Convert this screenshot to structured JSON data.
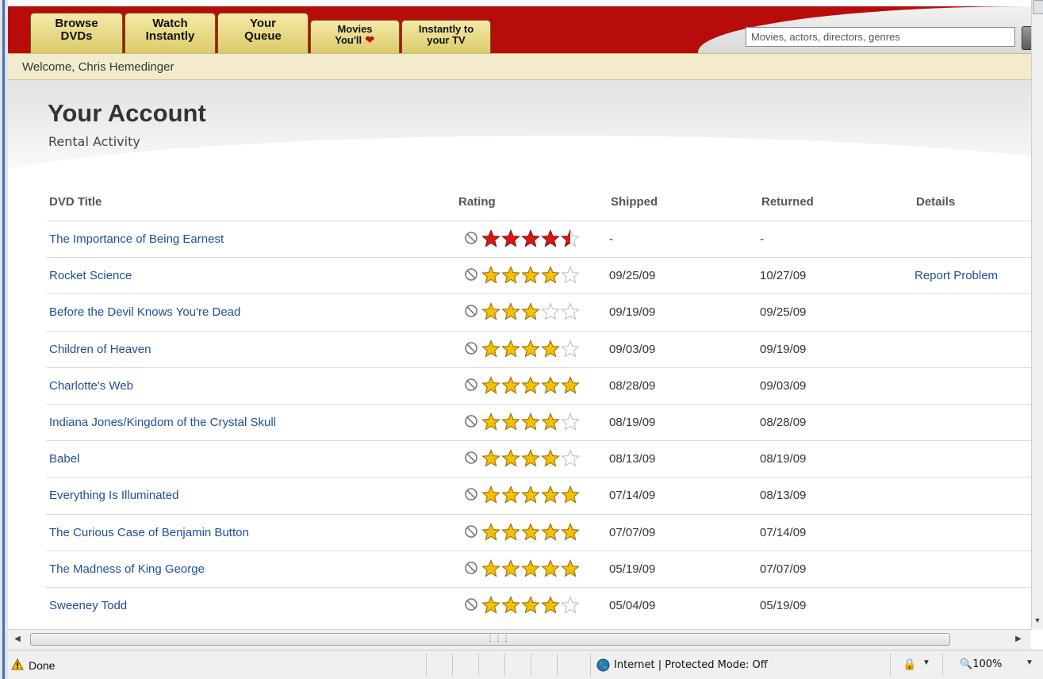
{
  "nav": {
    "tabs": [
      {
        "line1": "Browse",
        "line2": "DVDs"
      },
      {
        "line1": "Watch",
        "line2": "Instantly"
      },
      {
        "line1": "Your",
        "line2": "Queue"
      },
      {
        "line1": "Movies",
        "line2": "You'll"
      },
      {
        "line1": "Instantly to",
        "line2": "your TV"
      }
    ],
    "search_placeholder": "Movies, actors, directors, genres"
  },
  "welcome": "Welcome, Chris Hemedinger",
  "page": {
    "title": "Your Account",
    "subtitle": "Rental Activity"
  },
  "table": {
    "headers": {
      "title": "DVD Title",
      "rating": "Rating",
      "shipped": "Shipped",
      "returned": "Returned",
      "details": "Details"
    },
    "rows": [
      {
        "title": "The Importance of Being Earnest",
        "stars": 4.5,
        "star_color": "red",
        "shipped": "-",
        "returned": "-",
        "details": ""
      },
      {
        "title": "Rocket Science",
        "stars": 4,
        "star_color": "gold",
        "shipped": "09/25/09",
        "returned": "10/27/09",
        "details": "Report Problem"
      },
      {
        "title": "Before the Devil Knows You're Dead",
        "stars": 3,
        "star_color": "gold",
        "shipped": "09/19/09",
        "returned": "09/25/09",
        "details": ""
      },
      {
        "title": "Children of Heaven",
        "stars": 4,
        "star_color": "gold",
        "shipped": "09/03/09",
        "returned": "09/19/09",
        "details": ""
      },
      {
        "title": "Charlotte's Web",
        "stars": 5,
        "star_color": "gold",
        "shipped": "08/28/09",
        "returned": "09/03/09",
        "details": ""
      },
      {
        "title": "Indiana Jones/Kingdom of the Crystal Skull",
        "stars": 4,
        "star_color": "gold",
        "shipped": "08/19/09",
        "returned": "08/28/09",
        "details": ""
      },
      {
        "title": "Babel",
        "stars": 4,
        "star_color": "gold",
        "shipped": "08/13/09",
        "returned": "08/19/09",
        "details": ""
      },
      {
        "title": "Everything Is Illuminated",
        "stars": 5,
        "star_color": "gold",
        "shipped": "07/14/09",
        "returned": "08/13/09",
        "details": ""
      },
      {
        "title": "The Curious Case of Benjamin Button",
        "stars": 5,
        "star_color": "gold",
        "shipped": "07/07/09",
        "returned": "07/14/09",
        "details": ""
      },
      {
        "title": "The Madness of King George",
        "stars": 5,
        "star_color": "gold",
        "shipped": "05/19/09",
        "returned": "07/07/09",
        "details": ""
      },
      {
        "title": "Sweeney Todd",
        "stars": 4,
        "star_color": "gold",
        "shipped": "05/04/09",
        "returned": "05/19/09",
        "details": ""
      }
    ]
  },
  "status": {
    "text": "Done",
    "zone": "Internet | Protected Mode: Off",
    "zoom": "100%"
  },
  "icons": {
    "warning": "warning-icon",
    "globe": "internet-globe-icon",
    "no_interest": "not-interested-icon",
    "star": "star-icon",
    "heart": "heart-icon"
  },
  "colors": {
    "brand_red": "#b80c0c",
    "link_blue": "#1f4d9c",
    "star_gold": "#f5c000",
    "star_red": "#d81818"
  }
}
